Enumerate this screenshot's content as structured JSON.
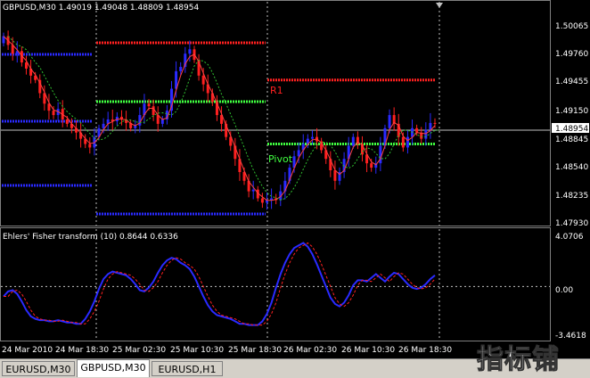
{
  "window": {
    "title": "GBPUSD,M30  1.49019 1.49048 1.48809 1.48954"
  },
  "price_axis": {
    "labels": [
      "1.50065",
      "1.49760",
      "1.49455",
      "1.49150",
      "1.48845",
      "1.48540",
      "1.48235",
      "1.47930"
    ],
    "current_price": "1.48954"
  },
  "pivot_labels": {
    "r1": "R1",
    "pivot": "Pivot"
  },
  "indicator": {
    "title": "Ehlers' Fisher transform (10) 0.8644 0.6336",
    "axis_labels": [
      "4.0706",
      "0.00",
      "-3.4618"
    ]
  },
  "time_axis": {
    "labels": [
      "24 Mar 2010",
      "24 Mar 18:30",
      "25 Mar 02:30",
      "25 Mar 10:30",
      "25 Mar 18:30",
      "26 Mar 02:30",
      "26 Mar 10:30",
      "26 Mar 18:30"
    ]
  },
  "tabs": [
    {
      "label": "EURUSD,M30",
      "active": false
    },
    {
      "label": "GBPUSD,M30",
      "active": true
    },
    {
      "label": "EURUSD,H1",
      "active": false
    }
  ],
  "watermark": "指标铺",
  "colors": {
    "bull_candle": "#2a2aff",
    "bear_candle": "#ff2020",
    "resistance": "#ff2020",
    "pivot": "#40ff40",
    "support": "#2a2aff",
    "fisher_main": "#2a2aff",
    "fisher_signal": "#ff2020"
  },
  "chart_data": {
    "type": "candlestick",
    "symbol": "GBPUSD",
    "timeframe": "M30",
    "price_range": [
      1.4781,
      1.5022
    ],
    "indicator_range": [
      -4.2,
      4.25
    ],
    "closes": [
      1.4995,
      1.4985,
      1.4975,
      1.4978,
      1.4965,
      1.4958,
      1.495,
      1.4945,
      1.493,
      1.4918,
      1.491,
      1.4905,
      1.4912,
      1.49,
      1.4895,
      1.489,
      1.4885,
      1.4878,
      1.4872,
      1.4868,
      1.488,
      1.489,
      1.4895,
      1.49,
      1.4898,
      1.4903,
      1.49,
      1.4896,
      1.489,
      1.4893,
      1.4905,
      1.4918,
      1.4915,
      1.4905,
      1.4895,
      1.49,
      1.491,
      1.4935,
      1.4955,
      1.496,
      1.4975,
      1.498,
      1.4968,
      1.495,
      1.494,
      1.493,
      1.492,
      1.4905,
      1.4895,
      1.488,
      1.487,
      1.4855,
      1.484,
      1.483,
      1.4818,
      1.482,
      1.481,
      1.4805,
      1.4808,
      1.481,
      1.4808,
      1.4818,
      1.483,
      1.4845,
      1.4858,
      1.4865,
      1.4872,
      1.4878,
      1.488,
      1.4875,
      1.4865,
      1.4855,
      1.4842,
      1.483,
      1.484,
      1.4855,
      1.487,
      1.488,
      1.4872,
      1.486,
      1.485,
      1.4845,
      1.485,
      1.487,
      1.489,
      1.4905,
      1.4895,
      1.488,
      1.4868,
      1.488,
      1.489,
      1.4885,
      1.4878,
      1.4888,
      1.4896,
      1.4895
    ],
    "fisher": [
      -0.8,
      -0.4,
      -0.3,
      -0.6,
      -1.2,
      -1.9,
      -2.4,
      -2.6,
      -2.7,
      -2.7,
      -2.8,
      -2.8,
      -2.7,
      -2.8,
      -2.9,
      -2.9,
      -3.0,
      -3.0,
      -2.6,
      -2.0,
      -1.2,
      -0.2,
      0.6,
      1.0,
      1.2,
      1.1,
      1.0,
      0.9,
      0.6,
      0.2,
      -0.3,
      -0.4,
      -0.1,
      0.4,
      1.1,
      1.7,
      2.1,
      2.3,
      2.2,
      1.9,
      1.7,
      1.4,
      0.8,
      0.0,
      -0.8,
      -1.5,
      -2.0,
      -2.3,
      -2.4,
      -2.5,
      -2.6,
      -2.8,
      -3.0,
      -3.0,
      -3.1,
      -3.1,
      -3.1,
      -2.8,
      -2.2,
      -1.3,
      -0.1,
      1.0,
      1.9,
      2.6,
      3.1,
      3.3,
      3.5,
      3.2,
      2.6,
      1.8,
      0.9,
      0.0,
      -0.9,
      -1.4,
      -1.6,
      -1.3,
      -0.7,
      0.1,
      0.5,
      0.5,
      0.4,
      0.7,
      1.0,
      0.7,
      0.4,
      0.8,
      1.1,
      1.0,
      0.6,
      0.2,
      -0.1,
      -0.2,
      -0.1,
      0.2,
      0.6,
      0.9
    ],
    "levels": [
      {
        "label": "R1",
        "price": 1.4945
      },
      {
        "label": "Pivot",
        "price": 1.4872
      }
    ]
  }
}
